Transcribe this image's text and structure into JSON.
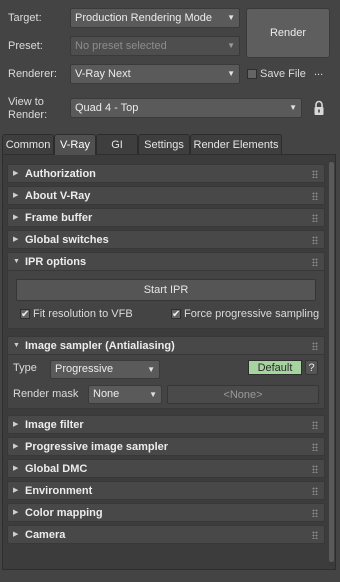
{
  "top": {
    "target_label": "Target:",
    "target_value": "Production Rendering Mode",
    "preset_label": "Preset:",
    "preset_value": "No preset selected",
    "renderer_label": "Renderer:",
    "renderer_value": "V-Ray Next",
    "save_file_label": "Save File",
    "save_file_checked": false,
    "more_label": "...",
    "view_label_line1": "View to",
    "view_label_line2": "Render:",
    "view_value": "Quad 4 - Top",
    "render_button": "Render",
    "lock_icon": "lock-icon"
  },
  "tabs": [
    {
      "label": "Common",
      "active": false
    },
    {
      "label": "V-Ray",
      "active": true
    },
    {
      "label": "GI",
      "active": false
    },
    {
      "label": "Settings",
      "active": false
    },
    {
      "label": "Render Elements",
      "active": false
    }
  ],
  "rollouts": {
    "authorization": "Authorization",
    "about": "About V-Ray",
    "frame_buffer": "Frame buffer",
    "global_switches": "Global switches",
    "ipr": "IPR options",
    "image_sampler": "Image sampler (Antialiasing)",
    "image_filter": "Image filter",
    "progressive": "Progressive image sampler",
    "global_dmc": "Global DMC",
    "environment": "Environment",
    "color_mapping": "Color mapping",
    "camera": "Camera"
  },
  "ipr": {
    "start_button": "Start IPR",
    "fit_resolution_label": "Fit resolution to VFB",
    "fit_resolution_checked": true,
    "force_progressive_label": "Force progressive sampling",
    "force_progressive_checked": true
  },
  "image_sampler": {
    "type_label": "Type",
    "type_value": "Progressive",
    "default_button": "Default",
    "help_button": "?",
    "render_mask_label": "Render mask",
    "render_mask_value": "None",
    "mask_object_value": "<None>"
  },
  "colors": {
    "background": "#444444",
    "panel": "#3c3c3c",
    "default_button": "#a6d3a0"
  }
}
